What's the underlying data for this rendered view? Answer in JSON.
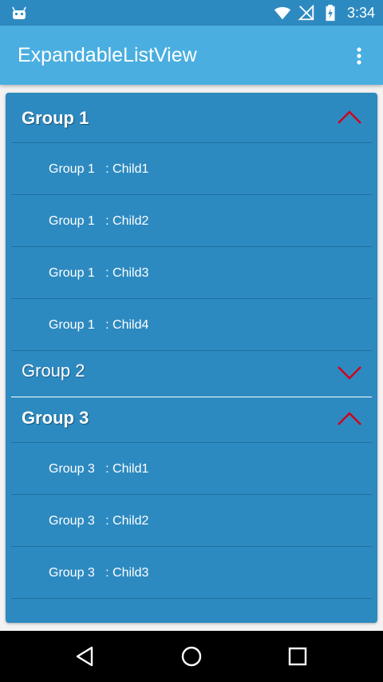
{
  "status_bar": {
    "time": "3:34",
    "icons": [
      "android-icon",
      "wifi-icon",
      "no-signal-icon",
      "battery-charging-icon"
    ]
  },
  "app_bar": {
    "title": "ExpandableListView",
    "menu_icon": "overflow-menu-icon"
  },
  "colors": {
    "status_bar": "#2d8ac0",
    "app_bar": "#4aaee0",
    "list_background": "#2d8ac0",
    "chevron": "#d0021b",
    "text": "#ffffff"
  },
  "list": {
    "groups": [
      {
        "label": "Group 1",
        "expanded": true,
        "children": [
          "Group 1   : Child1",
          "Group 1   : Child2",
          "Group 1   : Child3",
          "Group 1   : Child4"
        ]
      },
      {
        "label": "Group 2",
        "expanded": false,
        "children": []
      },
      {
        "label": "Group 3",
        "expanded": true,
        "children": [
          "Group 3   : Child1",
          "Group 3   : Child2",
          "Group 3   : Child3"
        ]
      }
    ]
  },
  "nav_bar": {
    "buttons": [
      "back-icon",
      "home-icon",
      "recents-icon"
    ]
  }
}
